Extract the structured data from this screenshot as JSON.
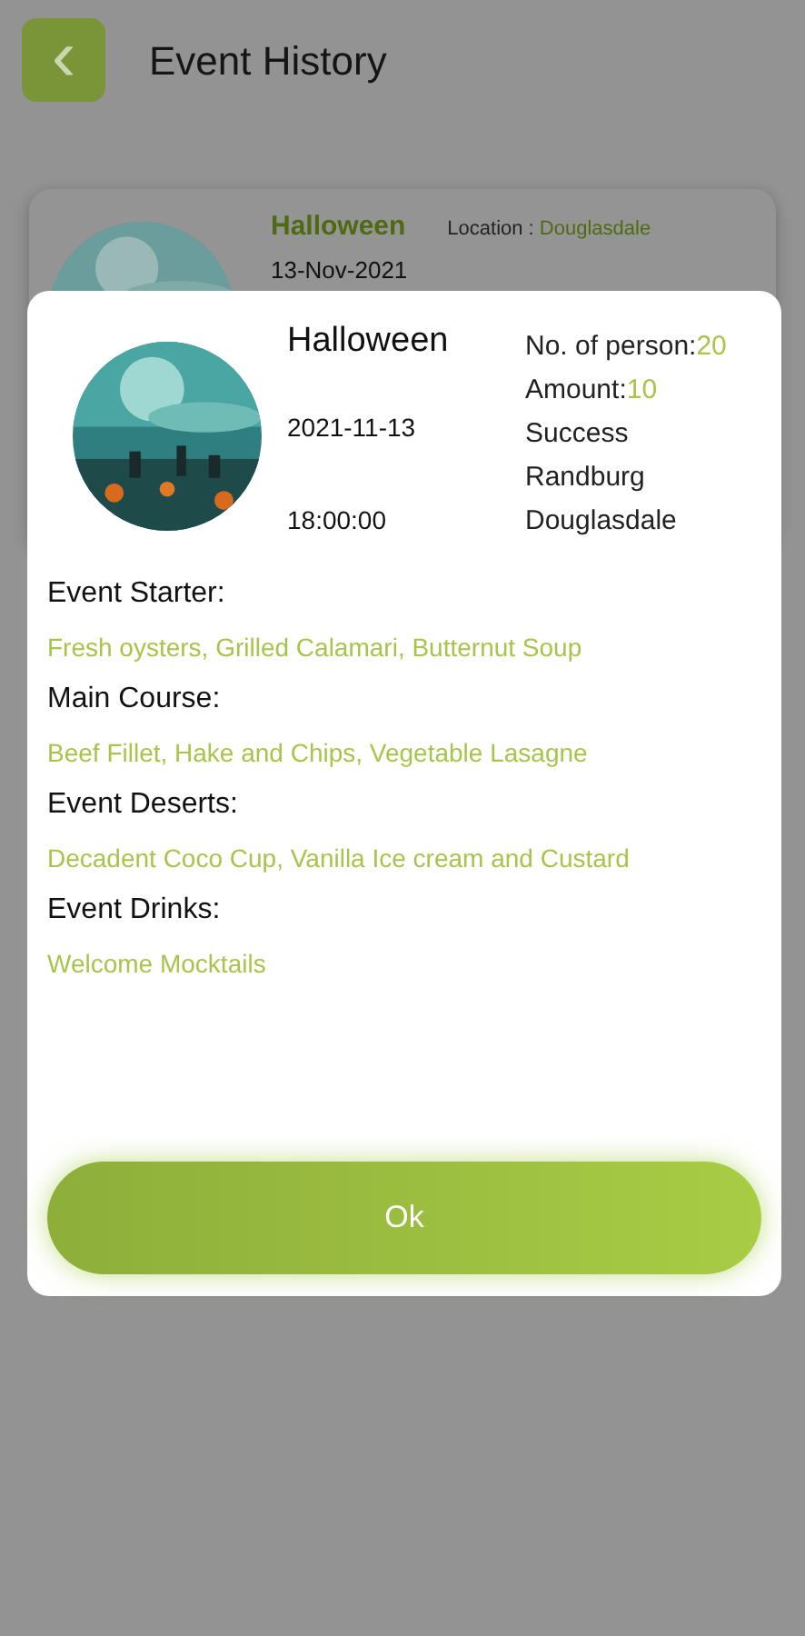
{
  "header": {
    "back": "‹",
    "title": "Event History"
  },
  "history_card": {
    "name": "Halloween",
    "date": "13-Nov-2021",
    "location_label": "Location :",
    "location": "Douglasdale"
  },
  "dialog": {
    "name": "Halloween",
    "date": "2021-11-13",
    "time": "18:00:00",
    "details": [
      {
        "label": "No. of person:",
        "value": "20"
      },
      {
        "label": "Amount:",
        "value": "10"
      },
      {
        "label": "Success"
      },
      {
        "label": "Randburg"
      },
      {
        "label": "Douglasdale"
      }
    ],
    "sections": [
      {
        "heading": "Event Starter:",
        "items": "Fresh oysters, Grilled Calamari, Butternut Soup"
      },
      {
        "heading": "Main Course:",
        "items": "Beef Fillet, Hake and Chips, Vegetable Lasagne"
      },
      {
        "heading": "Event Deserts:",
        "items": "Decadent Coco Cup, Vanilla Ice cream and Custard"
      },
      {
        "heading": "Event Drinks:",
        "items": "Welcome Mocktails"
      }
    ],
    "button": "Ok"
  }
}
